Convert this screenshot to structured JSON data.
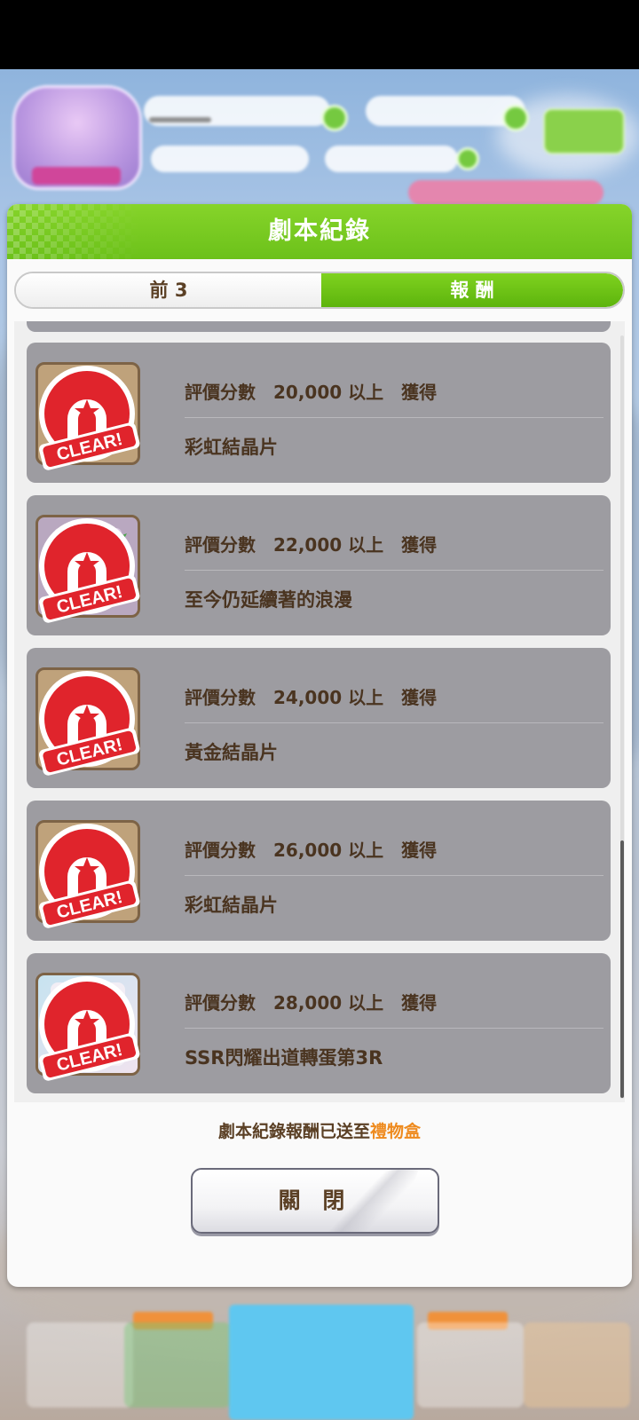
{
  "dialog": {
    "title": "劇本紀錄"
  },
  "tabs": [
    {
      "label": "前 3",
      "active": false
    },
    {
      "label": "報 酬",
      "active": true
    }
  ],
  "stamp_text": "CLEAR!",
  "rewards": [
    {
      "condition": "評價分數　20,000 以上　獲得",
      "item": "彩虹結晶片",
      "icon": "rainbow-crystal-icon",
      "cleared": true
    },
    {
      "condition": "評價分數　22,000 以上　獲得",
      "item": "至今仍延續著的浪漫",
      "icon": "skill-hint-icon",
      "cleared": true
    },
    {
      "condition": "評價分數　24,000 以上　獲得",
      "item": "黃金結晶片",
      "icon": "gold-crystal-icon",
      "cleared": true
    },
    {
      "condition": "評價分數　26,000 以上　獲得",
      "item": "彩虹結晶片",
      "icon": "rainbow-crystal-icon",
      "cleared": true
    },
    {
      "condition": "評價分數　28,000 以上　獲得",
      "item": "SSR閃耀出道轉蛋第3R",
      "icon": "gacha-ticket-icon",
      "cleared": true
    }
  ],
  "footer": {
    "note_prefix": "劇本紀錄報酬已送至",
    "note_link": "禮物盒"
  },
  "close_label": "關 閉",
  "colors": {
    "header_green": "#6cc11a",
    "stamp_red": "#e0242c",
    "text_brown": "#4a3420",
    "link_orange": "#ee8a1d"
  }
}
